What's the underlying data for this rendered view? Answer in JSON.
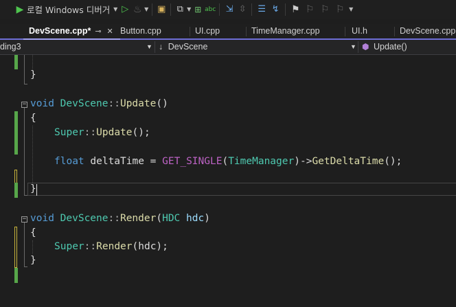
{
  "toolbar": {
    "run_label": "로컬 Windows 디버거",
    "icons": [
      "play-icon",
      "dropdown-icon",
      "start-without-debug-icon",
      "flame-icon",
      "browse-icon",
      "find-in-files-icon",
      "spell-check-icon",
      "step-icon",
      "bookmark-icon"
    ]
  },
  "tabs": [
    {
      "label": "DevScene.cpp*",
      "active": true,
      "pin": "⊸",
      "close": "✕"
    },
    {
      "label": "Button.cpp"
    },
    {
      "label": "UI.cpp"
    },
    {
      "label": "TimeManager.cpp"
    },
    {
      "label": "UI.h"
    },
    {
      "label": "DevScene.cpp"
    }
  ],
  "navbar": {
    "project": "ding3",
    "scope_icon": "↓",
    "scope": "DevScene",
    "member": "Update()"
  },
  "code": {
    "l1": "}",
    "update_void": "void",
    "update_cls": "DevScene",
    "update_sep": "::",
    "update_fn": "Update",
    "update_paren": "()",
    "brace_open": "{",
    "super": "Super",
    "super_sep": "::",
    "super_fn": "Update",
    "super_tail": "();",
    "float_kw": "float",
    "delta_var": " deltaTime = ",
    "macro": "GET_SINGLE",
    "paren_open": "(",
    "tm_cls": "TimeManager",
    "arrow": ")->",
    "get_fn": "GetDeltaTime",
    "get_tail": "();",
    "brace_close": "}",
    "render_void": "void",
    "render_cls": "DevScene",
    "render_sep": "::",
    "render_fn": "Render",
    "render_paren_open": "(",
    "hdc_type": "HDC",
    "hdc_param": " hdc",
    "render_paren_close": ")",
    "render_brace_open": "{",
    "rsuper": "Super",
    "rsuper_sep": "::",
    "rsuper_fn": "Render",
    "rsuper_tail": "(hdc);",
    "render_brace_close": "}"
  },
  "colors": {
    "keyword": "#569cd6",
    "class": "#4ec9b0",
    "function": "#dcdcaa",
    "macro": "#bd63c5",
    "change_saved": "#57a64a",
    "change_unsaved": "#c8b43c",
    "tab_accent": "#6e6ed6"
  }
}
